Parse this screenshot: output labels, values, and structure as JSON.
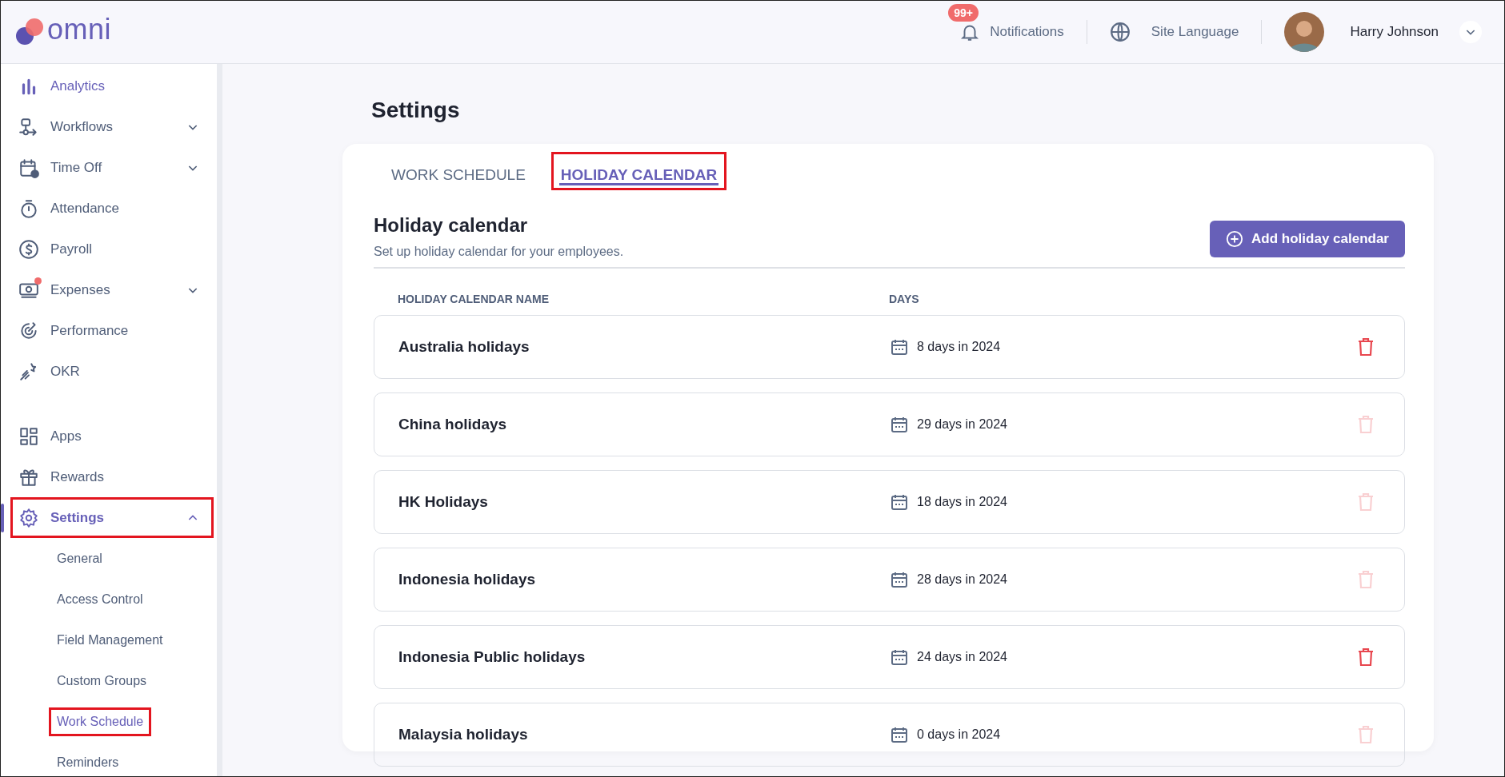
{
  "header": {
    "logo": "omni",
    "notifications": {
      "label": "Notifications",
      "badge": "99+"
    },
    "language": {
      "label": "Site Language"
    },
    "user": {
      "name": "Harry Johnson"
    }
  },
  "sidebar": {
    "groups": [
      {
        "items": [
          {
            "label": "Analytics",
            "selected": true,
            "highlighted": false,
            "dot": false
          },
          {
            "label": "Workflows",
            "selected": false,
            "highlighted": false,
            "expanded": false,
            "dot": false
          },
          {
            "label": "Time Off",
            "selected": false,
            "highlighted": false,
            "expanded": false,
            "dot": false
          },
          {
            "label": "Attendance",
            "selected": false,
            "highlighted": false,
            "dot": false
          },
          {
            "label": "Payroll",
            "selected": false,
            "highlighted": false,
            "dot": false
          },
          {
            "label": "Expenses",
            "selected": false,
            "highlighted": false,
            "expanded": false,
            "dot": true
          },
          {
            "label": "Performance",
            "selected": false,
            "highlighted": false,
            "dot": false
          },
          {
            "label": "OKR",
            "selected": false,
            "highlighted": false,
            "dot": false
          }
        ]
      },
      {
        "items": [
          {
            "label": "Apps",
            "selected": false,
            "highlighted": false,
            "dot": false
          },
          {
            "label": "Rewards",
            "selected": false,
            "highlighted": false,
            "dot": false
          },
          {
            "label": "Settings",
            "selected": true,
            "highlighted": true,
            "expanded": true,
            "dot": false,
            "children": [
              {
                "label": "General",
                "selected": false,
                "highlighted": false
              },
              {
                "label": "Access Control",
                "selected": false,
                "highlighted": false
              },
              {
                "label": "Field Management",
                "selected": false,
                "highlighted": false
              },
              {
                "label": "Custom Groups",
                "selected": false,
                "highlighted": false
              },
              {
                "label": "Work Schedule",
                "selected": true,
                "highlighted": true
              },
              {
                "label": "Reminders",
                "selected": false,
                "highlighted": false
              }
            ]
          }
        ]
      }
    ]
  },
  "page": {
    "title": "Settings",
    "tabs": [
      {
        "label": "WORK SCHEDULE",
        "selected": false,
        "highlighted": false
      },
      {
        "label": "HOLIDAY CALENDAR",
        "selected": true,
        "highlighted": true
      }
    ],
    "section": {
      "title": "Holiday calendar",
      "subtitle": "Set up holiday calendar for your employees.",
      "add_button": "Add holiday calendar"
    },
    "table": {
      "columns": [
        "HOLIDAY CALENDAR NAME",
        "DAYS"
      ],
      "rows": [
        {
          "name": "Australia holidays",
          "days": "8 days in 2024",
          "delete_disabled": false
        },
        {
          "name": "China holidays",
          "days": "29 days in 2024",
          "delete_disabled": true
        },
        {
          "name": "HK Holidays",
          "days": "18 days in 2024",
          "delete_disabled": true
        },
        {
          "name": "Indonesia holidays",
          "days": "28 days in 2024",
          "delete_disabled": true
        },
        {
          "name": "Indonesia Public holidays",
          "days": "24 days in 2024",
          "delete_disabled": false
        },
        {
          "name": "Malaysia holidays",
          "days": "0 days in 2024",
          "delete_disabled": true
        }
      ]
    }
  }
}
